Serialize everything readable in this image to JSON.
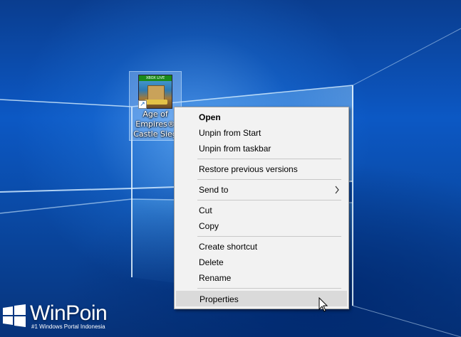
{
  "desktop": {
    "shortcut": {
      "badge": "XBOX LIVE",
      "label_lines": [
        "Age of",
        "Empires®",
        "Castle Sieg"
      ]
    }
  },
  "context_menu": {
    "items": [
      {
        "label": "Open",
        "bold": true
      },
      {
        "label": "Unpin from Start"
      },
      {
        "label": "Unpin from taskbar"
      },
      {
        "label": "Restore previous versions"
      },
      {
        "label": "Send to",
        "submenu": true
      },
      {
        "label": "Cut"
      },
      {
        "label": "Copy"
      },
      {
        "label": "Create shortcut"
      },
      {
        "label": "Delete"
      },
      {
        "label": "Rename"
      },
      {
        "label": "Properties",
        "highlighted": true
      }
    ]
  },
  "watermark": {
    "title": "WinPoin",
    "subtitle": "#1 Windows Portal Indonesia"
  },
  "colors": {
    "menu_bg": "#f2f2f2",
    "menu_hover": "#dadada",
    "desktop_blue": "#0c58c4"
  },
  "icons": [
    "shortcut-arrow-icon",
    "chevron-right-icon",
    "mouse-pointer-icon",
    "windows-logo-icon"
  ]
}
